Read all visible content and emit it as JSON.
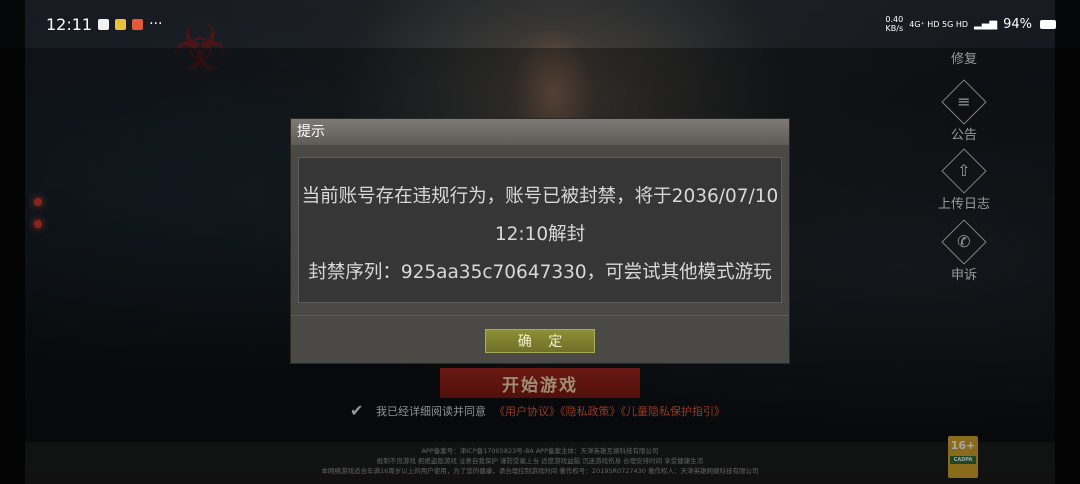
{
  "status_bar": {
    "time": "12:11",
    "net_speed_value": "0.40",
    "net_speed_unit": "KB/s",
    "network": "4G⁺ HD 5G HD",
    "battery": "94%"
  },
  "side_buttons": [
    {
      "label": "修复",
      "icon": "wrench-icon"
    },
    {
      "label": "公告",
      "icon": "notice-icon"
    },
    {
      "label": "上传日志",
      "icon": "upload-icon"
    },
    {
      "label": "申诉",
      "icon": "phone-icon"
    }
  ],
  "dialog": {
    "title": "提示",
    "message_line1": "当前账号存在违规行为，账号已被封禁，将于2036/07/10",
    "message_line2": "12:10解封",
    "message_line3": "封禁序列：925aa35c70647330，可尝试其他模式游玩",
    "confirm_label": "确 定"
  },
  "start_button_label": "开始游戏",
  "agreement": {
    "prefix": "我已经详细阅读并同意",
    "links": "《用户协议》《隐私政策》《儿童隐私保护指引》"
  },
  "footer": {
    "line1": "APP备案号：津ICP备17005823号-8A  APP备案主体：天津英雄互娱科技有限公司",
    "line2": "抵制不良游戏 拒绝盗版游戏 注意自我保护 谨防受骗上当 适度游戏益脑 沉迷游戏伤身 合理安排时间 享受健康生活",
    "line3": "本网络游戏适合年满16周岁以上的用户使用，为了您的健康，请合理控制游戏时间   著作权号：2019SR0727430   著作权人：天津英雄网娱科技有限公司",
    "age_rating": "16+",
    "age_rating_sub": "CADPA"
  },
  "colors": {
    "start_button": "#9a221c",
    "confirm_button": "#7f8030",
    "link": "#e05a3a"
  }
}
